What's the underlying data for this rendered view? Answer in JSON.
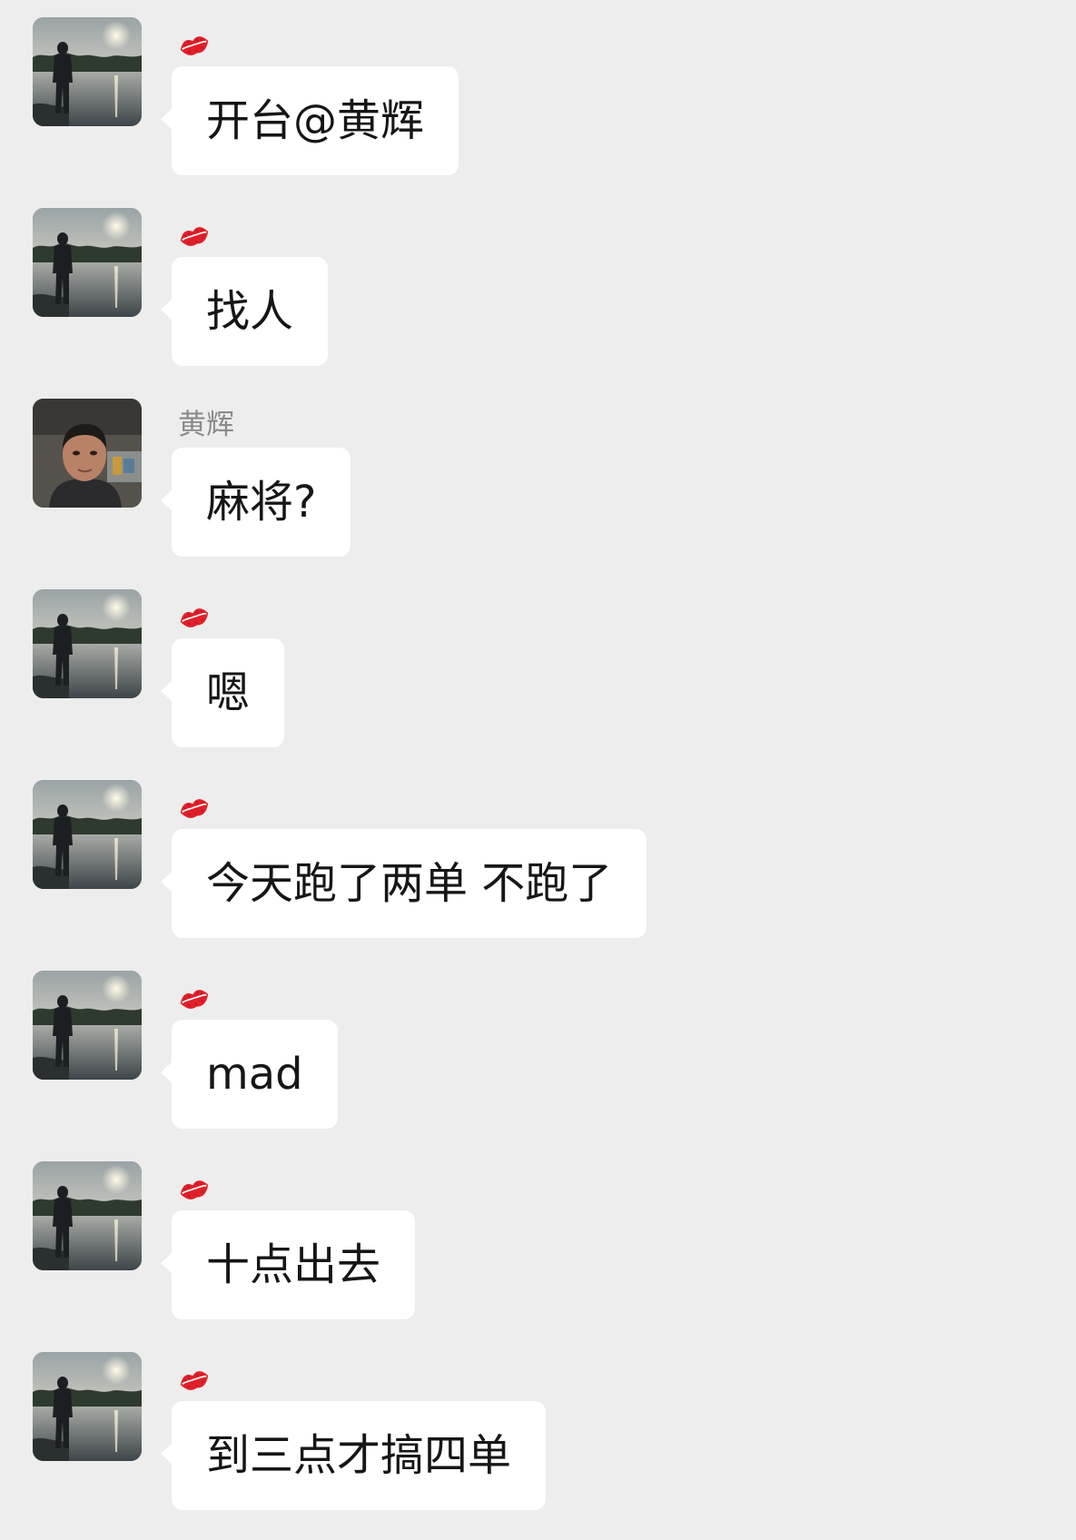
{
  "messages": [
    {
      "sender": "💋",
      "sender_kind": "emoji",
      "avatar": "silhouette-lake-avatar",
      "text": "开台@黄辉"
    },
    {
      "sender": "💋",
      "sender_kind": "emoji",
      "avatar": "silhouette-lake-avatar",
      "text": "找人"
    },
    {
      "sender": "黄辉",
      "sender_kind": "name",
      "avatar": "man-portrait-avatar",
      "text": "麻将?"
    },
    {
      "sender": "💋",
      "sender_kind": "emoji",
      "avatar": "silhouette-lake-avatar",
      "text": "嗯"
    },
    {
      "sender": "💋",
      "sender_kind": "emoji",
      "avatar": "silhouette-lake-avatar",
      "text": "今天跑了两单 不跑了"
    },
    {
      "sender": "💋",
      "sender_kind": "emoji",
      "avatar": "silhouette-lake-avatar",
      "text": "mad"
    },
    {
      "sender": "💋",
      "sender_kind": "emoji",
      "avatar": "silhouette-lake-avatar",
      "text": "十点出去"
    },
    {
      "sender": "💋",
      "sender_kind": "emoji",
      "avatar": "silhouette-lake-avatar",
      "text": "到三点才搞四单"
    }
  ],
  "colors": {
    "background": "#ededed",
    "bubble": "#ffffff",
    "message_text": "#161616",
    "sender_name": "#8a8a8a",
    "kiss": "#e0202a"
  }
}
